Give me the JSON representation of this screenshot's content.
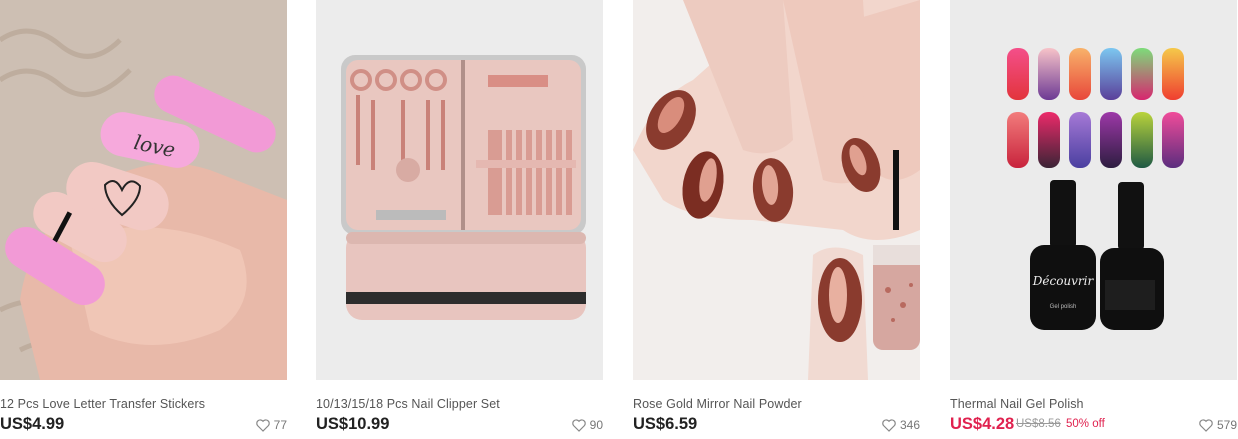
{
  "products": [
    {
      "title": "12 Pcs Love Letter Transfer Stickers",
      "price": "US$4.99",
      "likes": "77",
      "image_icon": "pink-nails-photo"
    },
    {
      "title": "10/13/15/18 Pcs Nail Clipper Set",
      "price": "US$10.99",
      "likes": "90",
      "image_icon": "manicure-kit-photo"
    },
    {
      "title": "Rose Gold Mirror Nail Powder",
      "price": "US$6.59",
      "likes": "346",
      "image_icon": "mirror-nails-photo"
    },
    {
      "title": "Thermal Nail Gel Polish",
      "price": "US$4.28",
      "original_price": "US$8.56",
      "discount": "50% off",
      "likes": "579",
      "image_icon": "gel-polish-photo",
      "brand_text": "Découvrir",
      "bottle_text": "Gel polish"
    }
  ],
  "colors": {
    "sale": "#e0224f",
    "text": "#222222",
    "muted": "#999999",
    "card_bg": "#ebebeb"
  }
}
